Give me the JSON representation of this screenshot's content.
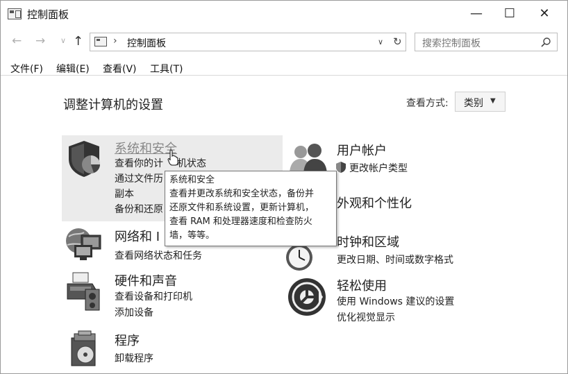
{
  "window": {
    "title": "控制面板",
    "minimize": "—",
    "maximize": "☐",
    "close": "✕"
  },
  "nav": {
    "back": "←",
    "forward": "→",
    "recent": "∨",
    "up": "↑",
    "refresh": "↻",
    "dropdown": "∨"
  },
  "address": {
    "separator": "›",
    "path": "控制面板"
  },
  "search": {
    "placeholder": "搜索控制面板"
  },
  "menu": [
    "文件(F)",
    "编辑(E)",
    "查看(V)",
    "工具(T)"
  ],
  "page": {
    "heading": "调整计算机的设置",
    "view_label": "查看方式:",
    "view_value": "类别",
    "view_arrow": "▼"
  },
  "categories": {
    "system": {
      "title": "系统和安全",
      "links": [
        "查看你的计",
        "机状态",
        "通过文件历",
        "副本",
        "备份和还原"
      ]
    },
    "network": {
      "title": "网络和 I",
      "links": [
        "查看网络状态和任务"
      ]
    },
    "hardware": {
      "title": "硬件和声音",
      "links": [
        "查看设备和打印机",
        "添加设备"
      ]
    },
    "programs": {
      "title": "程序",
      "links": [
        "卸载程序"
      ]
    },
    "users": {
      "title": "用户帐户",
      "links": [
        "更改帐户类型"
      ]
    },
    "appearance": {
      "title": "外观和个性化"
    },
    "clock": {
      "title": "时钟和区域",
      "links": [
        "更改日期、时间或数字格式"
      ]
    },
    "ease": {
      "title": "轻松使用",
      "links": [
        "使用 Windows 建议的设置",
        "优化视觉显示"
      ]
    }
  },
  "tooltip": {
    "lines": [
      "系统和安全",
      "查看并更改系统和安全状态，备份并",
      "还原文件和系统设置，更新计算机，",
      "查看 RAM 和处理器速度和检查防火",
      "墙，等等。"
    ]
  },
  "icons": [
    "control-panel-icon",
    "shield-icon",
    "network-icon",
    "printer-icon",
    "programs-icon",
    "users-icon",
    "uac-shield-icon",
    "clock-icon",
    "ease-of-access-icon",
    "search-icon",
    "hand-cursor-icon"
  ]
}
